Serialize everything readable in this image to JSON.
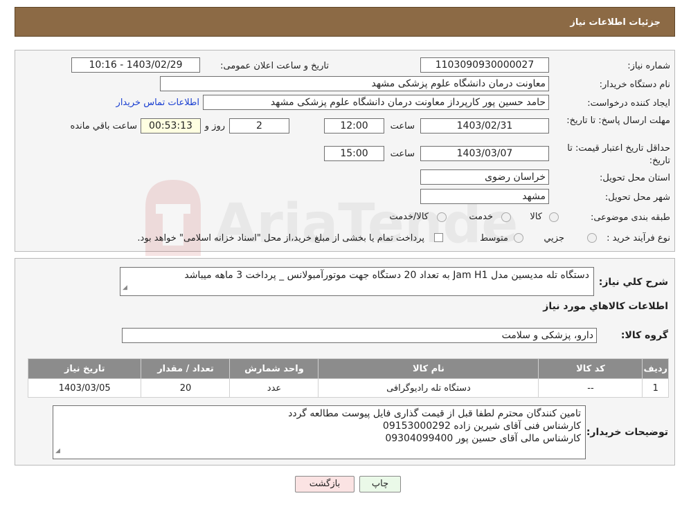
{
  "header": {
    "title": "جزئیات اطلاعات نیاز"
  },
  "form": {
    "need_number_label": "شماره نیاز:",
    "need_number": "1103090930000027",
    "announce_label": "تاریخ و ساعت اعلان عمومی:",
    "announce_value": "1403/02/29 - 10:16",
    "buyer_org_label": "نام دستگاه خریدار:",
    "buyer_org": "معاونت درمان دانشگاه علوم پزشکی مشهد",
    "creator_label": "ایجاد کننده درخواست:",
    "creator": "حامد حسین پور کارپرداز معاونت درمان دانشگاه علوم پزشکی مشهد",
    "contact_link": "اطلاعات تماس خریدار",
    "deadline_label": "مهلت ارسال پاسخ: تا تاریخ:",
    "deadline_date": "1403/02/31",
    "time_label": "ساعت",
    "deadline_time": "12:00",
    "days_value": "2",
    "days_label": "روز و",
    "remaining_time": "00:53:13",
    "remaining_label": "ساعت باقي مانده",
    "validity_label": "حداقل تاریخ اعتبار قیمت: تا تاریخ:",
    "validity_date": "1403/03/07",
    "validity_time": "15:00",
    "province_label": "استان محل تحویل:",
    "province": "خراسان رضوی",
    "city_label": "شهر محل تحویل:",
    "city": "مشهد",
    "category_label": "طبقه بندی موضوعی:",
    "category_options": [
      "کالا",
      "خدمت",
      "کالا/خدمت"
    ],
    "process_label": "نوع فرآیند خرید :",
    "process_options": [
      "جزيي",
      "متوسط"
    ],
    "process_note": "پرداخت تمام یا بخشی از مبلغ خرید،از محل \"اسناد خزانه اسلامی\" خواهد بود."
  },
  "summary": {
    "label": "شرح کلي نياز:",
    "text": "دستگاه تله مدیسین مدل Jam H1 به تعداد 20 دستگاه جهت موتورآمبولانس _ پرداخت 3 ماهه میباشد",
    "goods_info_title": "اطلاعات کالاهاي مورد نياز",
    "group_label": "گروه کالا:",
    "group_value": "دارو، پزشکی و سلامت"
  },
  "table": {
    "headers": [
      "رديف",
      "کد کالا",
      "نام کالا",
      "واحد شمارش",
      "تعداد / مقدار",
      "تاریخ نیاز"
    ],
    "rows": [
      [
        "1",
        "--",
        "دستگاه تله رادیوگرافی",
        "عدد",
        "20",
        "1403/03/05"
      ]
    ]
  },
  "buyer_notes": {
    "label": "توضیحات خریدار:",
    "lines": [
      "تامین کنندگان محترم لطفا قبل از قیمت گذاری فایل پیوست مطالعه گردد",
      "کارشناس فنی آقای شیرین زاده 09153000292",
      "کارشناس مالی آقای حسین پور  09304099400"
    ]
  },
  "buttons": {
    "print": "چاپ",
    "back": "بازگشت"
  },
  "watermark": {
    "text": "AriaTender.neT"
  }
}
